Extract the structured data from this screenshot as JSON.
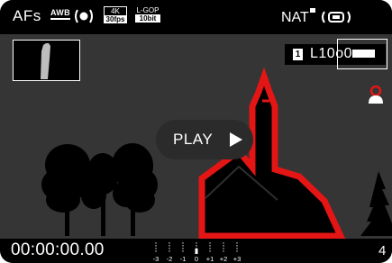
{
  "status": {
    "af_mode": "AFs",
    "white_balance": "AWB",
    "stabilization_icon": "stabilization-icon",
    "video_format": {
      "line1": "4K",
      "line2": "30fps"
    },
    "compression": {
      "line1": "L-GOP",
      "line2": "10bit"
    },
    "film_style": "NAT",
    "audio_icon": "stabilization-icon"
  },
  "storage": {
    "card_slot": "1",
    "remaining": "L10o0"
  },
  "playback": {
    "label": "PLAY",
    "icon": "play-icon"
  },
  "footer": {
    "timecode": "00:00:00.00",
    "meter_labels": [
      "-3",
      "-2",
      "-1",
      "0",
      "+1",
      "+2",
      "+3"
    ],
    "meter_level": 0,
    "battery_indicator": "4"
  },
  "colors": {
    "focus_peaking": "#e41515",
    "background": "#353535",
    "bar": "#000000",
    "text": "#ffffff"
  }
}
